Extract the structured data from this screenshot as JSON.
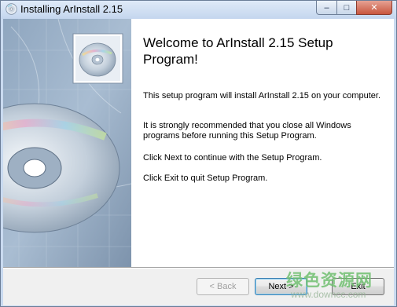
{
  "window": {
    "title": "Installing ArInstall 2.15",
    "caption_buttons": {
      "minimize": "–",
      "maximize": "□",
      "close": "✕"
    }
  },
  "banner": {
    "description_icon": "cd-disc-icon"
  },
  "content": {
    "heading": "Welcome to ArInstall 2.15 Setup Program!",
    "paragraphs": [
      "This setup program will install ArInstall 2.15 on your computer.",
      "It is strongly  recommended that you close all Windows programs before running this Setup Program.",
      "Click Next to continue with the Setup Program.",
      "Click Exit to quit Setup Program."
    ]
  },
  "buttons": {
    "back": "< Back",
    "next": "Next >",
    "exit": "Exit"
  },
  "watermark": {
    "cn": "绿色资源网",
    "en": "www.downcc.com"
  }
}
